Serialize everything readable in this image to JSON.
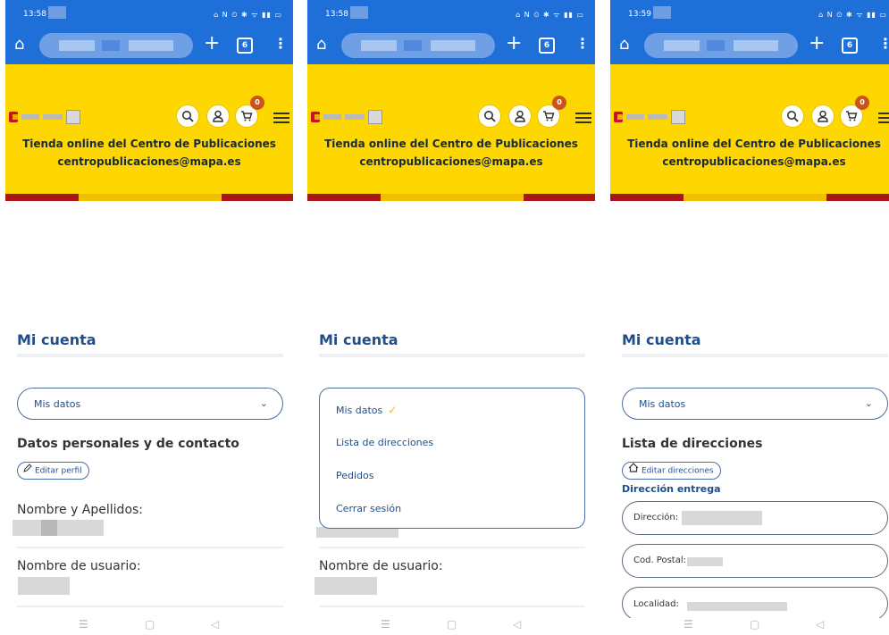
{
  "status_times": [
    "13:58",
    "13:58",
    "13:59"
  ],
  "status_icons": "⌂ N ⏲ ✱ ᯤ ▮▮ ▭",
  "browser": {
    "home_icon": "home-icon",
    "plus": "+",
    "tab_count": "6",
    "menu": "⋮"
  },
  "banner": {
    "title": "Tienda online del Centro de Publicaciones",
    "email": "centropublicaciones@mapa.es",
    "cart_count": "0"
  },
  "account": {
    "title": "Mi cuenta",
    "selected": "Mis datos",
    "options": [
      "Mis datos",
      "Lista de direcciones",
      "Pedidos",
      "Cerrar sesión"
    ]
  },
  "profile": {
    "heading": "Datos personales y de contacto",
    "edit_label": "Editar perfil",
    "name_label": "Nombre y Apellidos:",
    "user_label": "Nombre de usuario:"
  },
  "addresses": {
    "heading": "Lista de direcciones",
    "edit_label": "Editar direcciones",
    "section": "Dirección entrega",
    "fields": [
      "Dirección:",
      "Cod. Postal:",
      "Localidad:"
    ]
  },
  "navbar": {
    "recents": "☰",
    "home": "▢",
    "back": "◁"
  },
  "colors": {
    "brand_blue": "#1f6fd8",
    "banner_yellow": "#ffd700",
    "accent_red": "#aa151b",
    "link_blue": "#1f4e8c"
  }
}
